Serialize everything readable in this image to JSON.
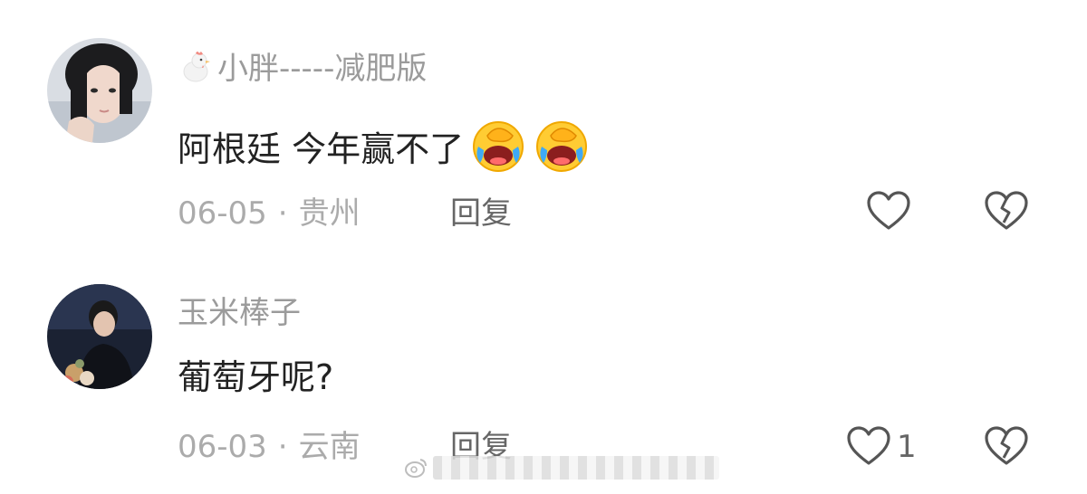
{
  "comments": [
    {
      "username": "小胖-----减肥版",
      "badge_icon": "chicken-icon",
      "text": "阿根廷 今年赢不了",
      "emojis": [
        "laugh-cry-emoji",
        "laugh-cry-emoji"
      ],
      "date": "06-05",
      "separator": "·",
      "location": "贵州",
      "reply_label": "回复",
      "like_icon": "heart-outline-icon",
      "like_count": "",
      "dislike_icon": "broken-heart-icon"
    },
    {
      "username": "玉米棒子",
      "text": "葡萄牙呢?",
      "date": "06-03",
      "separator": "·",
      "location": "云南",
      "reply_label": "回复",
      "like_icon": "heart-outline-icon",
      "like_count": "1",
      "dislike_icon": "broken-heart-icon"
    }
  ],
  "colors": {
    "username": "#9b9b9b",
    "content": "#222222",
    "meta": "#ababab",
    "reply": "#666666",
    "icon_stroke": "#555555"
  }
}
